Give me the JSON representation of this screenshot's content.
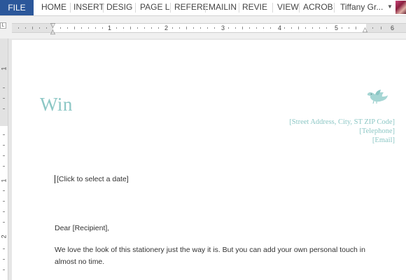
{
  "ribbon": {
    "file_label": "FILE",
    "tabs": [
      {
        "label": "HOME"
      },
      {
        "label": "INSERT"
      },
      {
        "label": "DESIG"
      },
      {
        "label": "PAGE L"
      },
      {
        "label": "REFERE"
      },
      {
        "label": "MAILIN"
      },
      {
        "label": "REVIE"
      },
      {
        "label": "VIEW"
      },
      {
        "label": "ACROB"
      }
    ],
    "user_name": "Tiffany Gr...",
    "accent_color": "#2b579a"
  },
  "ruler": {
    "horizontal_numbers": [
      "1",
      "2",
      "3",
      "4",
      "5",
      "6"
    ],
    "vertical_numbers": [
      "1",
      "1",
      "2"
    ],
    "corner_glyph": "L"
  },
  "document": {
    "title": "Win",
    "title_color": "#8cc7c5",
    "address": {
      "street": "[Street Address, City, ST ZIP Code]",
      "telephone": "[Telephone]",
      "email": "[Email]"
    },
    "date_field": "[Click to select a date]",
    "salutation": "Dear [Recipient],",
    "body_line1": "We love the look of this stationery just the way it is. But you can add your own personal touch in",
    "body_line2": "almost no time."
  },
  "icons": {
    "bird": "bird-icon",
    "caret": "chevron-down-icon"
  }
}
